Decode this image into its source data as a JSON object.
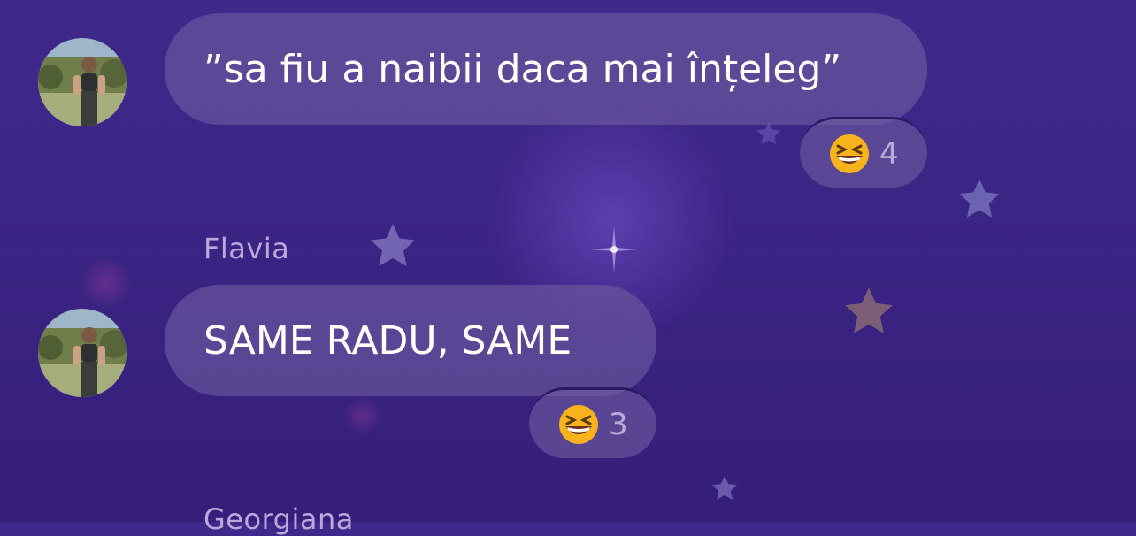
{
  "messages": [
    {
      "sender": "",
      "text": "”sa fiu a naibii daca mai înțeleg”",
      "reaction": {
        "emoji": "grinning-squinting-face",
        "count": "4"
      }
    },
    {
      "sender": "Flavia",
      "text": "SAME RADU, SAME",
      "reaction": {
        "emoji": "grinning-squinting-face",
        "count": "3"
      }
    }
  ],
  "next_sender_partial": "Georgiana",
  "colors": {
    "background": "#3b2585",
    "bubble": "#6e5ca0",
    "name": "#b9a9dd",
    "emoji": "#f7b21c"
  }
}
